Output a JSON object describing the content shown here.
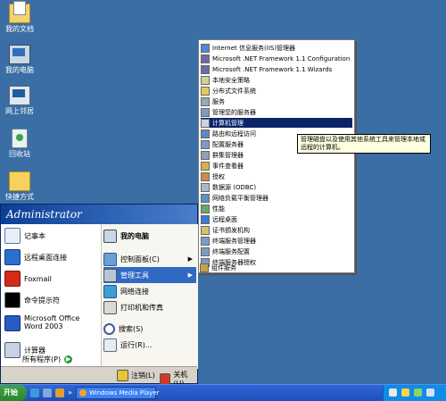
{
  "desktop": {
    "icons": [
      {
        "label": "我的文档"
      },
      {
        "label": "我的电脑"
      },
      {
        "label": "网上邻居"
      },
      {
        "label": "回收站"
      },
      {
        "label": "快捷方式"
      }
    ]
  },
  "start_menu": {
    "user": "Administrator",
    "left_items": [
      {
        "label": "记事本",
        "icon": "notepad-icon"
      },
      {
        "label": "远程桌面连接",
        "icon": "remote-desktop-icon"
      },
      {
        "label": "Foxmail",
        "icon": "foxmail-icon"
      },
      {
        "label": "命令提示符",
        "icon": "cmd-icon"
      },
      {
        "label": "Microsoft Office Word 2003",
        "icon": "word-icon"
      },
      {
        "label": "计算器",
        "icon": "calculator-icon"
      }
    ],
    "all_programs": "所有程序(P)",
    "right_items": [
      {
        "label": "我的电脑",
        "icon": "computer-icon"
      },
      {
        "label": "控制面板(C)",
        "icon": "control-panel-icon",
        "arrow": true
      },
      {
        "label": "管理工具",
        "icon": "admin-tools-icon",
        "arrow": true
      },
      {
        "label": "网络连接",
        "icon": "network-icon"
      },
      {
        "label": "打印机和传真",
        "icon": "printer-icon"
      },
      {
        "label": "搜索(S)",
        "icon": "search-icon"
      },
      {
        "label": "运行(R)...",
        "icon": "run-icon"
      }
    ],
    "logoff": "注销(L)",
    "shutdown": "关机(U)"
  },
  "submenu": {
    "items": [
      "Internet 信息服务(IIS)管理器",
      "Microsoft .NET Framework 1.1 Configuration",
      "Microsoft .NET Framework 1.1 Wizards",
      "本地安全策略",
      "分布式文件系统",
      "服务",
      "管理您的服务器",
      "计算机管理",
      "路由和远程访问",
      "配置服务器",
      "群集管理器",
      "事件查看器",
      "授权",
      "数据源 (ODBC)",
      "网络负载平衡管理器",
      "性能",
      "远程桌面",
      "证书颁发机构",
      "终端服务管理器",
      "终端服务配置",
      "终端服务器授权",
      "组件服务"
    ],
    "selected_index": 7
  },
  "tooltip": {
    "text": "管理磁盘以及使用其他系统工具来管理本地或远程的计算机。"
  },
  "taskbar": {
    "start_label": "开始",
    "task_label": "Windows Media Player"
  },
  "colors": {
    "desktop": "#3a6ea5",
    "start_header": "#0b3f96",
    "selection": "#316ac5",
    "submenu_selection": "#0a246a",
    "taskbar": "#245edb",
    "start_button": "#3fa542"
  }
}
